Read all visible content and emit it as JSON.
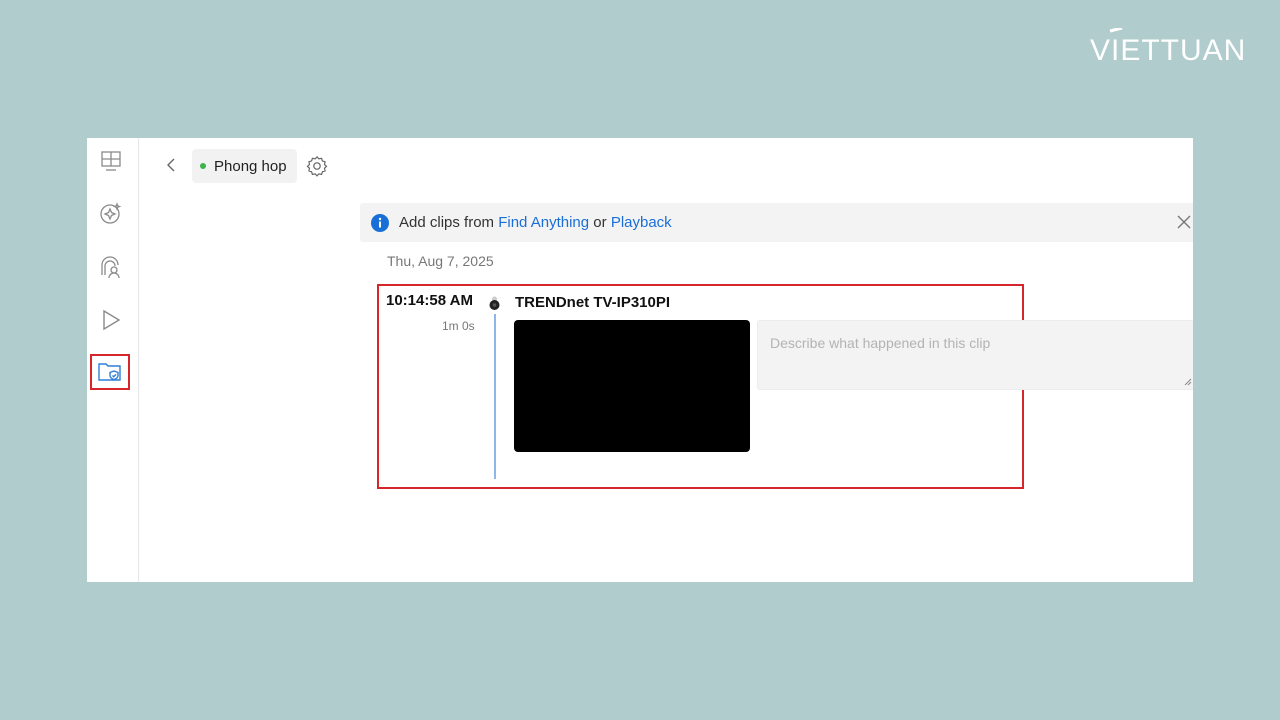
{
  "brand": {
    "logo_text": "VIETTUAN"
  },
  "sidebar": {
    "items": [
      {
        "icon": "grid-layout-icon"
      },
      {
        "icon": "ai-search-icon"
      },
      {
        "icon": "person-detection-icon"
      },
      {
        "icon": "play-icon"
      },
      {
        "icon": "folder-shield-icon",
        "active": true
      }
    ]
  },
  "header": {
    "camera_name": "Phong hop",
    "status_color": "#3bb54a"
  },
  "info_bar": {
    "prefix": "Add clips from",
    "link1": "Find Anything",
    "middle": "or",
    "link2": "Playback"
  },
  "timeline": {
    "date": "Thu, Aug 7, 2025",
    "clip": {
      "time": "10:14:58 AM",
      "duration": "1m 0s",
      "camera": "TRENDnet TV-IP310PI",
      "description_placeholder": "Describe what happened in this clip"
    }
  },
  "colors": {
    "background": "#b1cccd",
    "accent_link": "#1a6fd6",
    "highlight_red": "#d7262b"
  }
}
